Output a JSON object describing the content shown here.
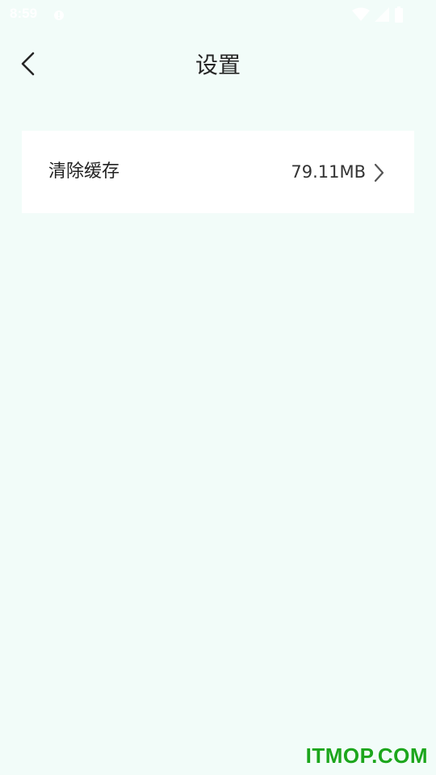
{
  "status_bar": {
    "time": "8:59",
    "icons": [
      "notification-icon",
      "wifi-icon",
      "signal-icon",
      "battery-icon"
    ]
  },
  "header": {
    "back_icon": "chevron-left-icon",
    "title": "设置"
  },
  "settings": {
    "items": [
      {
        "label": "清除缓存",
        "value": "79.11MB",
        "icon": "chevron-right-icon"
      }
    ]
  },
  "watermark": "ITMOP.COM",
  "colors": {
    "background": "#f2fcf9",
    "card": "#ffffff",
    "watermark": "#1ca61c"
  }
}
